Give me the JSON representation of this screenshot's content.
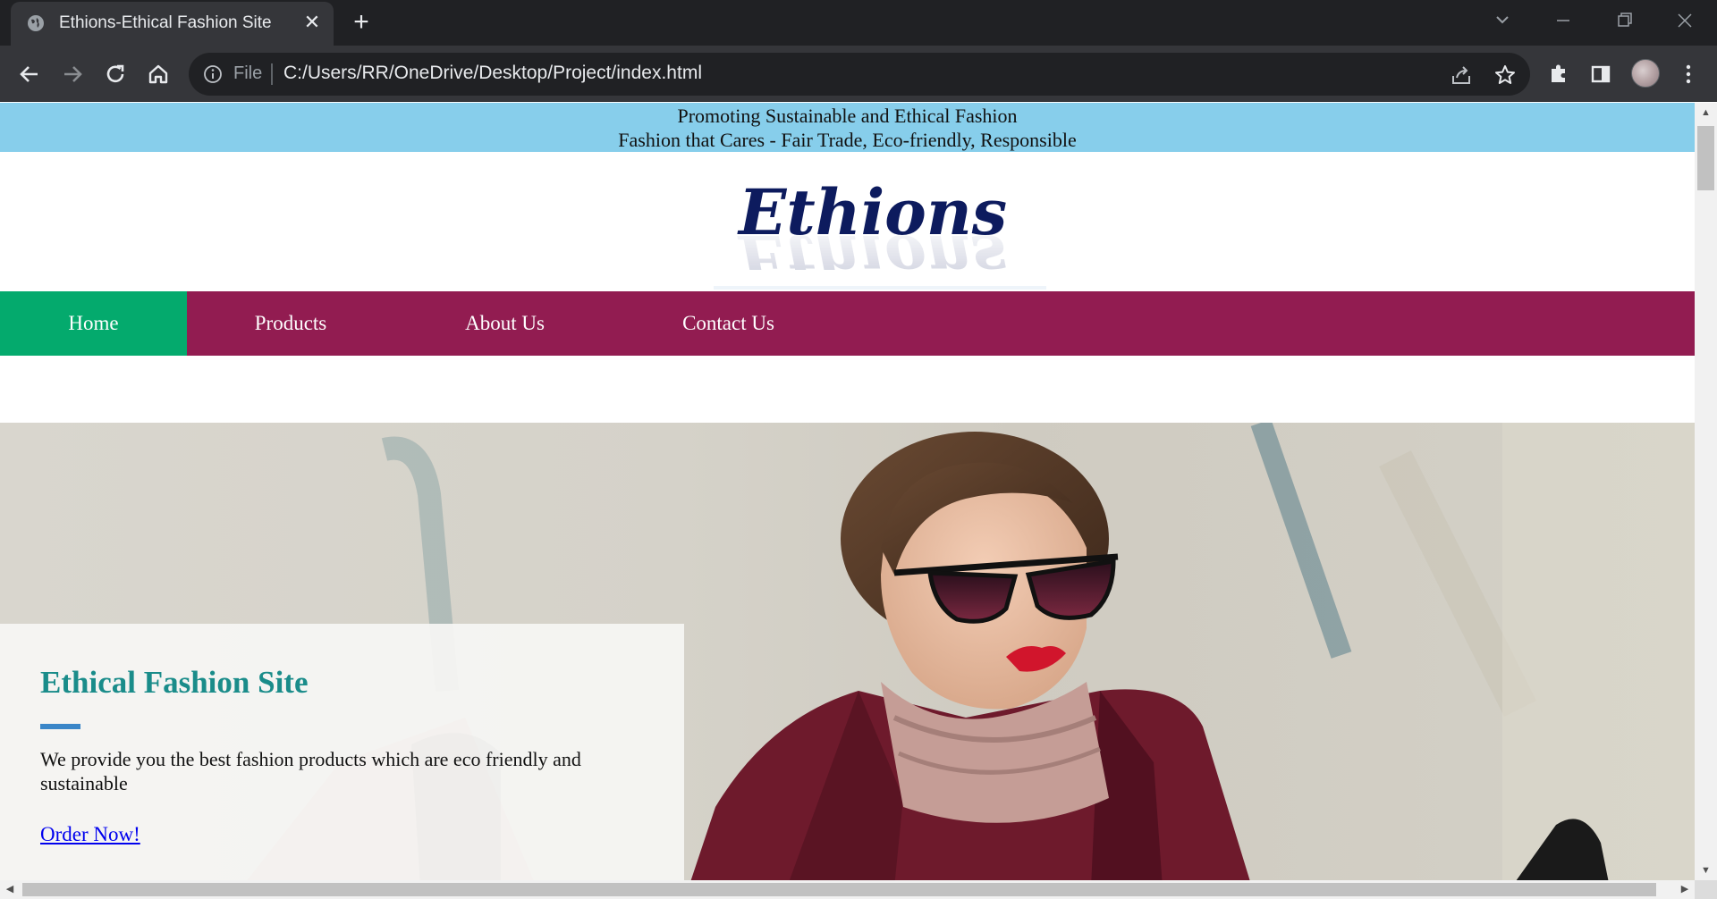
{
  "browser": {
    "tab": {
      "title": "Ethions-Ethical Fashion Site"
    },
    "omnibox": {
      "scheme_label": "File",
      "url": "C:/Users/RR/OneDrive/Desktop/Project/index.html"
    }
  },
  "site": {
    "announcement": {
      "line1": "Promoting Sustainable and Ethical Fashion",
      "line2": "Fashion that Cares - Fair Trade, Eco-friendly, Responsible"
    },
    "logo": {
      "text": "Ethions",
      "color": "#0d1b5e"
    },
    "nav": {
      "items": [
        {
          "label": "Home",
          "active": true
        },
        {
          "label": "Products",
          "active": false
        },
        {
          "label": "About Us",
          "active": false
        },
        {
          "label": "Contact Us",
          "active": false
        }
      ],
      "colors": {
        "background": "#921c51",
        "active": "#04aa6d"
      }
    },
    "hero": {
      "title": "Ethical Fashion Site",
      "description": "We provide you the best fashion products which are eco friendly and sustainable",
      "cta_label": "Order Now!",
      "title_color": "#1a8c8a",
      "accent_color": "#3a86c8"
    },
    "announcement_color": "#87ceeb"
  }
}
